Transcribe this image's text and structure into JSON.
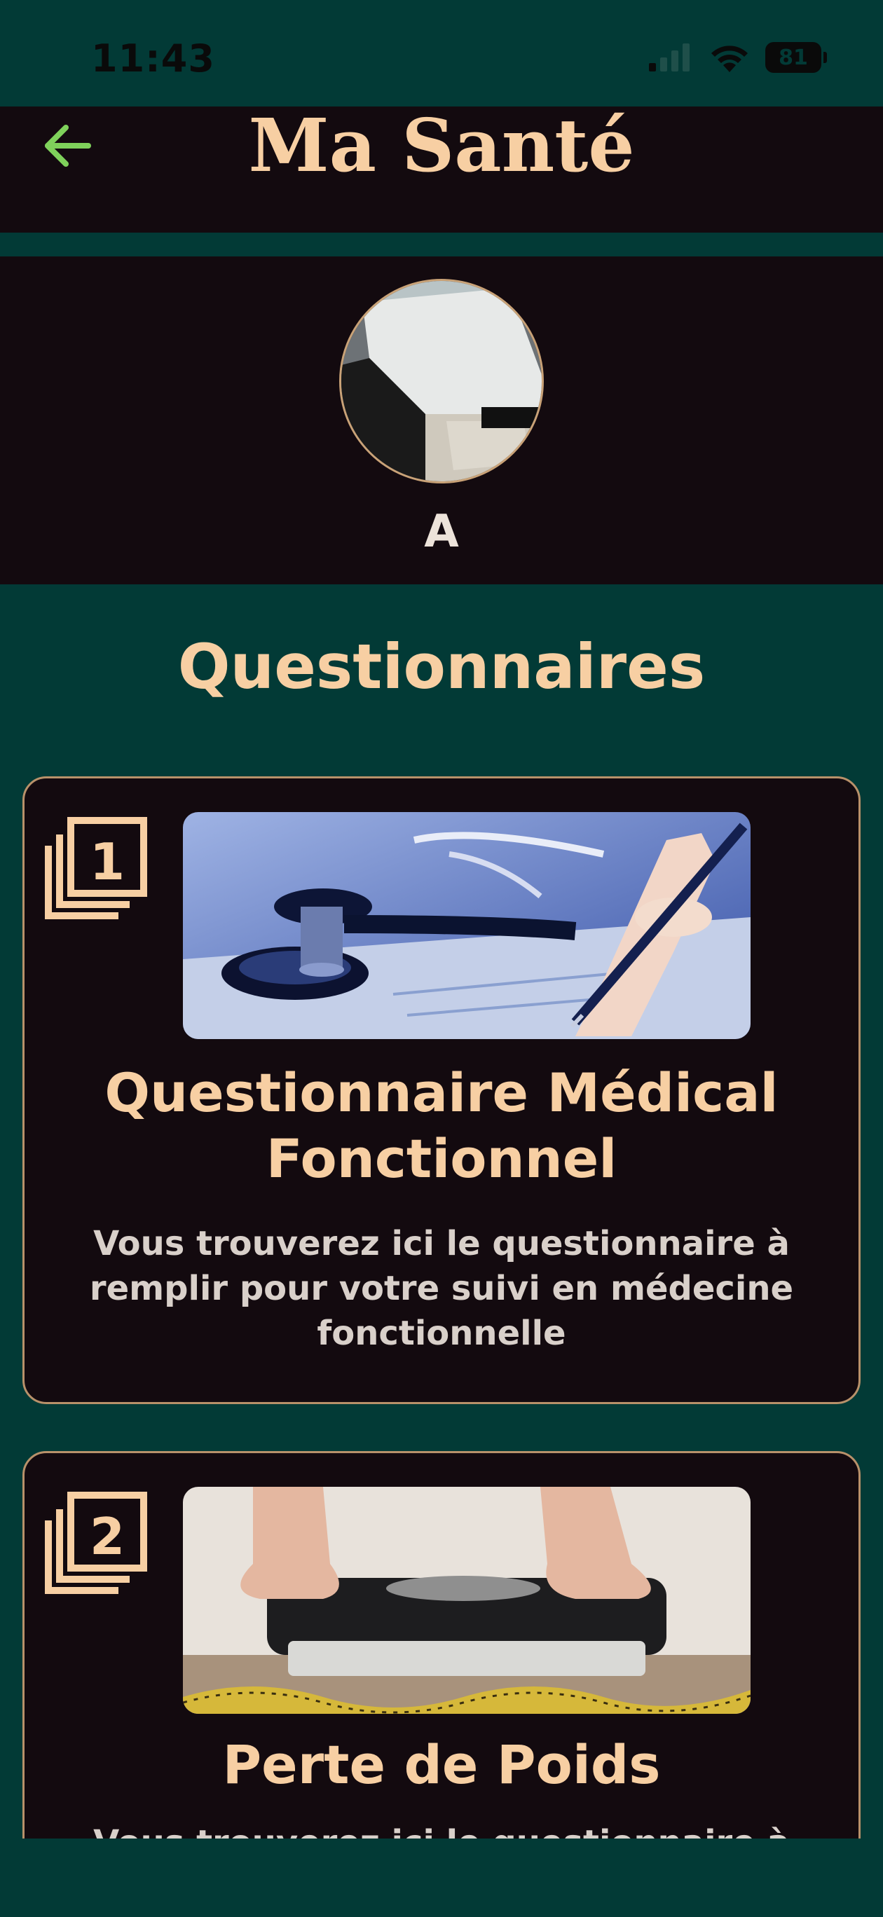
{
  "status_bar": {
    "time": "11:43",
    "battery": "81",
    "icons": [
      "signal-icon",
      "wifi-icon",
      "battery-icon"
    ]
  },
  "header": {
    "title": "Ma Santé",
    "back_icon": "arrow-left-icon"
  },
  "profile": {
    "name": "A"
  },
  "section": {
    "title": "Questionnaires"
  },
  "cards": [
    {
      "number": "1",
      "title": "Questionnaire Médical Fonctionnel",
      "description": "Vous trouverez ici le questionnaire à remplir pour votre suivi en médecine fonctionnelle",
      "image": "stethoscope-and-pen-image"
    },
    {
      "number": "2",
      "title": "Perte de Poids",
      "description": "Vous trouverez ici le questionnaire à",
      "image": "feet-on-scale-image"
    }
  ],
  "colors": {
    "background": "#023A36",
    "panel": "#130A0F",
    "accent": "#F7CFA3",
    "back_arrow": "#7FD15B",
    "border": "#B8916A"
  }
}
